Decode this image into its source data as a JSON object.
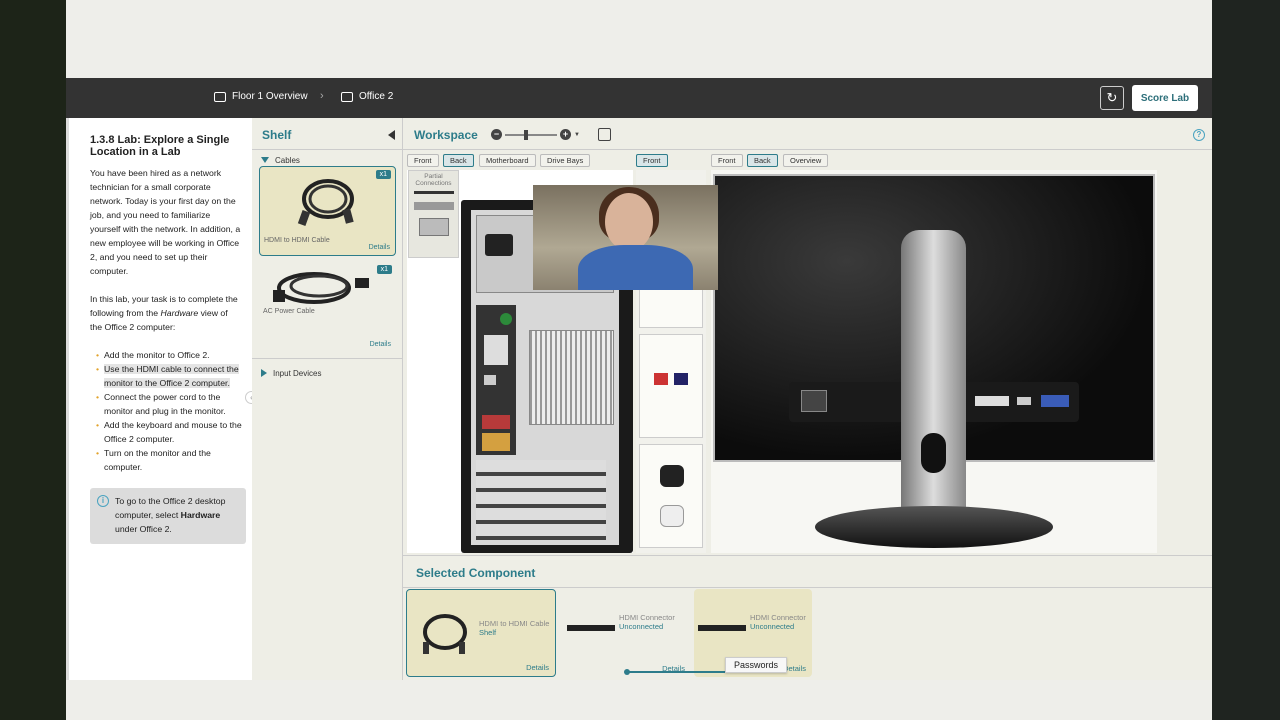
{
  "breadcrumbs": [
    {
      "label": "Floor 1 Overview",
      "icon": "building-icon"
    },
    {
      "label": "Office 2",
      "icon": "monitor-icon"
    }
  ],
  "topbar": {
    "score_label": "Score Lab",
    "refresh_icon": "refresh-icon"
  },
  "instructions": {
    "title": "1.3.8 Lab: Explore a Single Location in a Lab",
    "intro": "You have been hired as a network technician for a small corporate network. Today is your first day on the job, and you need to familiarize yourself with the network. In addition, a new employee will be working in Office 2, and you need to set up their computer.",
    "task_prefix": "In this lab, your task is to complete the following from the ",
    "task_em": "Hardware",
    "task_suffix": " view of the Office 2 computer:",
    "steps": [
      "Add the monitor to Office 2.",
      "Use the HDMI cable to connect the monitor to the Office 2 computer.",
      "Connect the power cord to the monitor and plug in the monitor.",
      "Add the keyboard and mouse to the Office 2 computer.",
      "Turn on the monitor and the computer."
    ],
    "tip_prefix": "To go to the Office 2 desktop computer, select ",
    "tip_bold": "Hardware",
    "tip_suffix": " under Office 2."
  },
  "shelf": {
    "title": "Shelf",
    "category_open": "Cables",
    "category_closed": "Input Devices",
    "items": [
      {
        "name": "HDMI to HDMI Cable",
        "count": "x1",
        "details": "Details"
      },
      {
        "name": "AC Power Cable",
        "count": "x1",
        "details": "Details"
      }
    ]
  },
  "workspace": {
    "title": "Workspace",
    "tower_tabs": [
      "Front",
      "Back",
      "Motherboard",
      "Drive Bays"
    ],
    "partial_label": "Partial Connections",
    "wall_tabs": [
      "Front"
    ],
    "monitor_tabs": [
      "Front",
      "Back",
      "Overview"
    ]
  },
  "selected": {
    "title": "Selected Component",
    "cards": [
      {
        "name": "HDMI to HDMI Cable",
        "status": "Shelf",
        "details": "Details"
      },
      {
        "name": "HDMI Connector",
        "status": "Unconnected",
        "details": "Details"
      },
      {
        "name": "HDMI Connector",
        "status": "Unconnected",
        "details": "Details"
      }
    ],
    "tooltip": "Passwords"
  },
  "colors": {
    "accent": "#2d7c8a",
    "topbar": "#333333",
    "selected_card": "#e9e5c4"
  }
}
